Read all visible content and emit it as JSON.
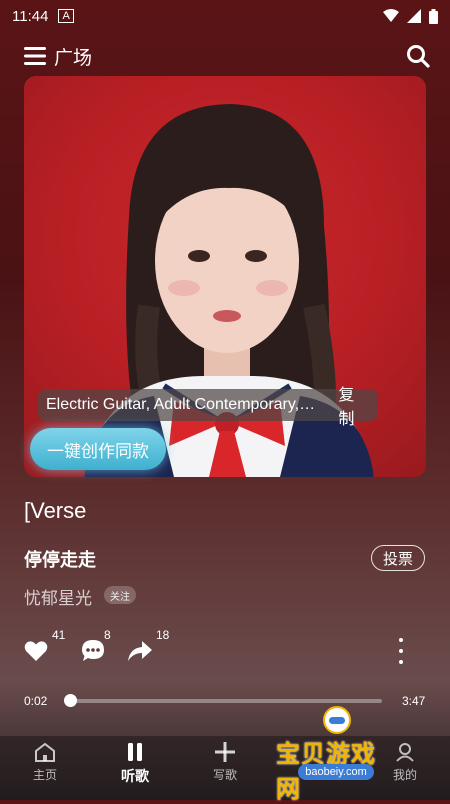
{
  "status_bar": {
    "time": "11:44",
    "notif_glyph": "A"
  },
  "header": {
    "menu_icon": "menu-icon",
    "title": "广场",
    "search_icon": "search-icon"
  },
  "cover": {
    "tags": "Electric Guitar, Adult Contemporary, Pop",
    "copy_label": "复制",
    "create_label": "一键创作同款"
  },
  "song": {
    "lyric_line": "[Verse",
    "title": "停停走走",
    "vote_label": "投票",
    "artist": "忧郁星光",
    "follow_label": "关注"
  },
  "actions": {
    "likes": "41",
    "comments": "8",
    "shares": "18"
  },
  "player": {
    "current_time": "0:02",
    "total_time": "3:47",
    "progress": 0.01
  },
  "nav": [
    {
      "label": "主页",
      "icon": "home-icon"
    },
    {
      "label": "听歌",
      "icon": "pause-icon"
    },
    {
      "label": "写歌",
      "icon": "plus-icon"
    },
    {
      "label": "",
      "icon": ""
    },
    {
      "label": "我的",
      "icon": "profile-icon"
    }
  ],
  "watermark": {
    "text": "宝贝游戏网",
    "url": "baobeiy.com"
  }
}
